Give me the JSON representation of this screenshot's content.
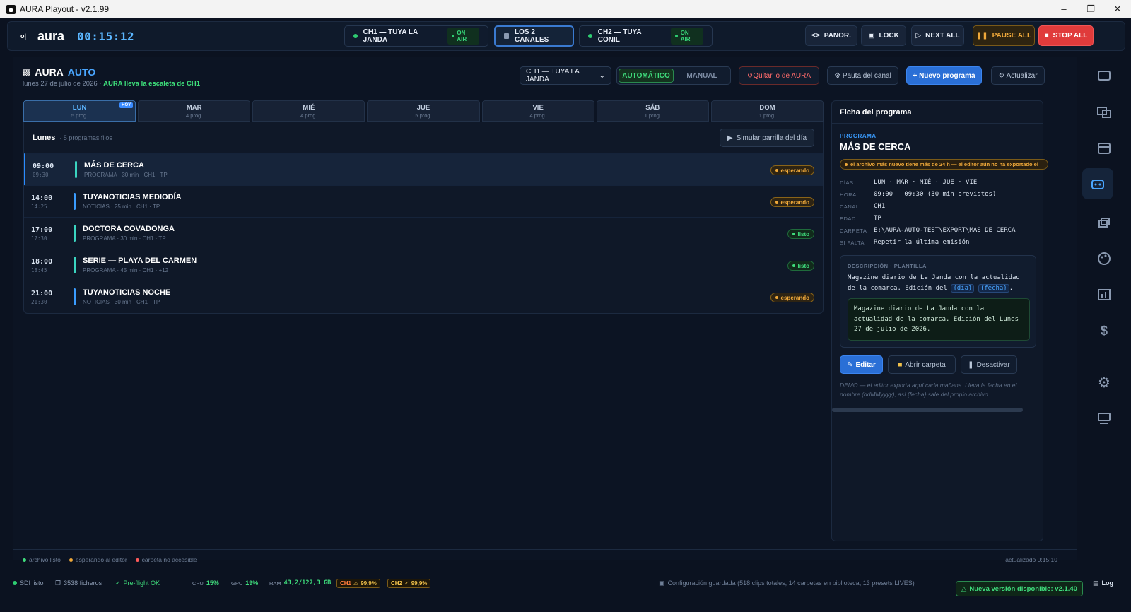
{
  "window": {
    "title": "AURA Playout - v2.1.99"
  },
  "topbar": {
    "logo": "aura",
    "clock": "00:15:12",
    "channels": [
      {
        "label": "CH1 — TUYA LA JANDA",
        "status": "ON AIR"
      },
      {
        "label": "LOS 2 CANALES"
      },
      {
        "label": "CH2 — TUYA CONIL",
        "status": "ON AIR"
      }
    ],
    "actions": {
      "panor": "PANOR.",
      "lock": "LOCK",
      "next_all": "NEXT ALL",
      "pause_all": "PAUSE ALL",
      "stop_all": "STOP ALL"
    }
  },
  "auto": {
    "title_a": "AURA",
    "title_b": "AUTO",
    "date": "lunes 27 de julio de 2026",
    "sep": "·",
    "note": "AURA lleva la escaleta de CH1",
    "channel_select": "CH1 — TUYA LA JANDA",
    "mode_auto": "AUTOMÁTICO",
    "mode_manual": "MANUAL",
    "remove": "Quitar lo de AURA",
    "pauta": "Pauta del canal",
    "new_program": "+ Nuevo programa",
    "refresh": "Actualizar"
  },
  "days": [
    {
      "name": "LUN",
      "count": "5 prog.",
      "hoy": "HOY"
    },
    {
      "name": "MAR",
      "count": "4 prog."
    },
    {
      "name": "MIÉ",
      "count": "4 prog."
    },
    {
      "name": "JUE",
      "count": "5 prog."
    },
    {
      "name": "VIE",
      "count": "4 prog."
    },
    {
      "name": "SÁB",
      "count": "1 prog."
    },
    {
      "name": "DOM",
      "count": "1 prog."
    }
  ],
  "schedule": {
    "title": "Lunes",
    "count": "· 5 programas fijos",
    "simulate": "Simular parrilla del día",
    "rows": [
      {
        "start": "09:00",
        "end": "09:30",
        "name": "MÁS DE CERCA",
        "meta": "PROGRAMA · 30 min · CH1 · TP",
        "status": "esperando",
        "bar": "#3ad4c0"
      },
      {
        "start": "14:00",
        "end": "14:25",
        "name": "TUYANOTICIAS MEDIODÍA",
        "meta": "NOTICIAS · 25 min · CH1 · TP",
        "status": "esperando",
        "bar": "#3a9cff"
      },
      {
        "start": "17:00",
        "end": "17:30",
        "name": "DOCTORA COVADONGA",
        "meta": "PROGRAMA · 30 min · CH1 · TP",
        "status": "listo",
        "bar": "#3ad4c0"
      },
      {
        "start": "18:00",
        "end": "18:45",
        "name": "SERIE — PLAYA DEL CARMEN",
        "meta": "PROGRAMA · 45 min · CH1 · +12",
        "status": "listo",
        "bar": "#3ad4c0"
      },
      {
        "start": "21:00",
        "end": "21:30",
        "name": "TUYANOTICIAS NOCHE",
        "meta": "NOTICIAS · 30 min · CH1 · TP",
        "status": "esperando",
        "bar": "#3a9cff"
      }
    ]
  },
  "legend": {
    "ready": "archivo listo",
    "waiting": "esperando al editor",
    "missing": "carpeta no accesible",
    "updated": "actualizado 0:15:10"
  },
  "ficha": {
    "header": "Ficha del programa",
    "kind": "PROGRAMA",
    "name": "MÁS DE CERCA",
    "warning": "el archivo más nuevo tiene más de 24 h — el editor aún no ha exportado el",
    "fields": [
      {
        "k": "DÍAS",
        "v": "LUN · MAR · MIÉ · JUE · VIE"
      },
      {
        "k": "HORA",
        "v": "09:00 – 09:30 (30 min previstos)"
      },
      {
        "k": "CANAL",
        "v": "CH1"
      },
      {
        "k": "EDAD",
        "v": "TP"
      },
      {
        "k": "CARPETA",
        "v": "E:\\AURA-AUTO-TEST\\EXPORT\\MAS_DE_CERCA"
      },
      {
        "k": "SI FALTA",
        "v": "Repetir la última emisión"
      }
    ],
    "desc_title": "DESCRIPCIÓN · PLANTILLA",
    "desc_pre": "Magazine diario de La Janda con la actualidad de la comarca. Edición del ",
    "tok_dia": "{día}",
    "tok_fecha": "{fecha}",
    "desc_post": ".",
    "preview": "Magazine diario de La Janda con la actualidad de la comarca. Edición del Lunes 27 de julio de 2026.",
    "edit": "Editar",
    "open_folder": "Abrir carpeta",
    "deactivate": "Desactivar",
    "demo": "DEMO — el editor exporta aquí cada mañana. Lleva la fecha en el nombre (ddMMyyyy), así {fecha} sale del propio archivo."
  },
  "status": {
    "sdi": "SDI listo",
    "files": "3538 ficheros",
    "preflight": "Pre-flight OK",
    "cpu_label": "CPU",
    "cpu": "15%",
    "gpu_label": "GPU",
    "gpu": "19%",
    "ram_label": "RAM",
    "ram": "43,2/127,3 GB",
    "ch1_label": "CH1",
    "ch1": "99,9%",
    "ch2_label": "CH2",
    "ch2": "99,9%",
    "config": "Configuración guardada (518 clips totales, 14 carpetas en biblioteca, 13 presets LIVES)",
    "new_version": "Nueva versión disponible: v2.1.40",
    "log": "Log"
  }
}
